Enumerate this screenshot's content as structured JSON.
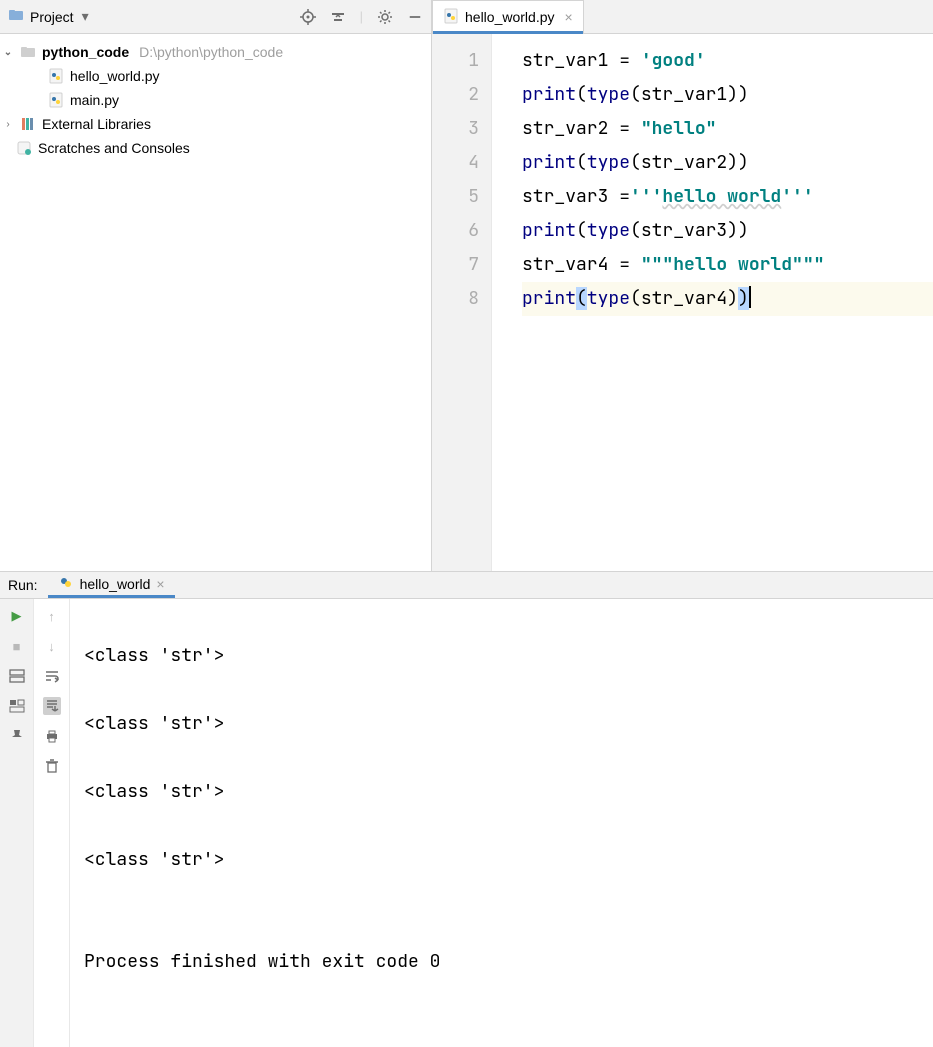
{
  "colors": {
    "tab_underline": "#4a88c7",
    "string_token": "#008080",
    "keyword_token": "#000080"
  },
  "project_panel": {
    "title": "Project",
    "toolbar_icons": [
      "locate-icon",
      "collapse-icon",
      "settings-icon",
      "hide-icon"
    ],
    "tree": {
      "root": {
        "label": "python_code",
        "path": "D:\\python\\python_code",
        "expanded": true
      },
      "files": [
        {
          "label": "hello_world.py",
          "icon": "python"
        },
        {
          "label": "main.py",
          "icon": "python"
        }
      ],
      "extras": [
        {
          "label": "External Libraries",
          "icon": "libraries",
          "expandable": true
        },
        {
          "label": "Scratches and Consoles",
          "icon": "scratches",
          "expandable": false
        }
      ]
    }
  },
  "editor": {
    "tabs": [
      {
        "label": "hello_world.py",
        "icon": "python",
        "active": true
      }
    ],
    "line_numbers": [
      "1",
      "2",
      "3",
      "4",
      "5",
      "6",
      "7",
      "8"
    ],
    "current_line_index": 7,
    "code": {
      "l1": {
        "var": "str_var1",
        "eq": " = ",
        "q1": "'",
        "s": "good",
        "q2": "'"
      },
      "l2": {
        "fn": "print",
        "p1": "(",
        "bi": "type",
        "p2": "(",
        "v": "str_var1",
        "p3": ")",
        "p4": ")"
      },
      "l3": {
        "var": "str_var2",
        "eq": " = ",
        "q1": "\"",
        "s": "hello",
        "q2": "\""
      },
      "l4": {
        "fn": "print",
        "p1": "(",
        "bi": "type",
        "p2": "(",
        "v": "str_var2",
        "p3": ")",
        "p4": ")"
      },
      "l5": {
        "var": "str_var3",
        "eq": " =",
        "q1": "'''",
        "s": "hello world",
        "q2": "'''"
      },
      "l6": {
        "fn": "print",
        "p1": "(",
        "bi": "type",
        "p2": "(",
        "v": "str_var3",
        "p3": ")",
        "p4": ")"
      },
      "l7": {
        "var": "str_var4",
        "eq": " = ",
        "q1": "\"\"\"",
        "s": "hello world",
        "q2": "\"\"\""
      },
      "l8": {
        "fn": "print",
        "p1": "(",
        "bi": "type",
        "p2": "(",
        "v": "str_var4",
        "p3": ")",
        "p4": ")"
      }
    }
  },
  "run_panel": {
    "label": "Run:",
    "tab": "hello_world",
    "left_icons": [
      "rerun",
      "stop",
      "layout",
      "toggle-soft-wrap",
      "pin"
    ],
    "left_icons2": [
      "up",
      "down",
      "wrap",
      "scroll-to-end",
      "print",
      "delete"
    ],
    "output_lines": [
      "<class 'str'>",
      "<class 'str'>",
      "<class 'str'>",
      "<class 'str'>",
      "",
      "Process finished with exit code 0"
    ]
  }
}
